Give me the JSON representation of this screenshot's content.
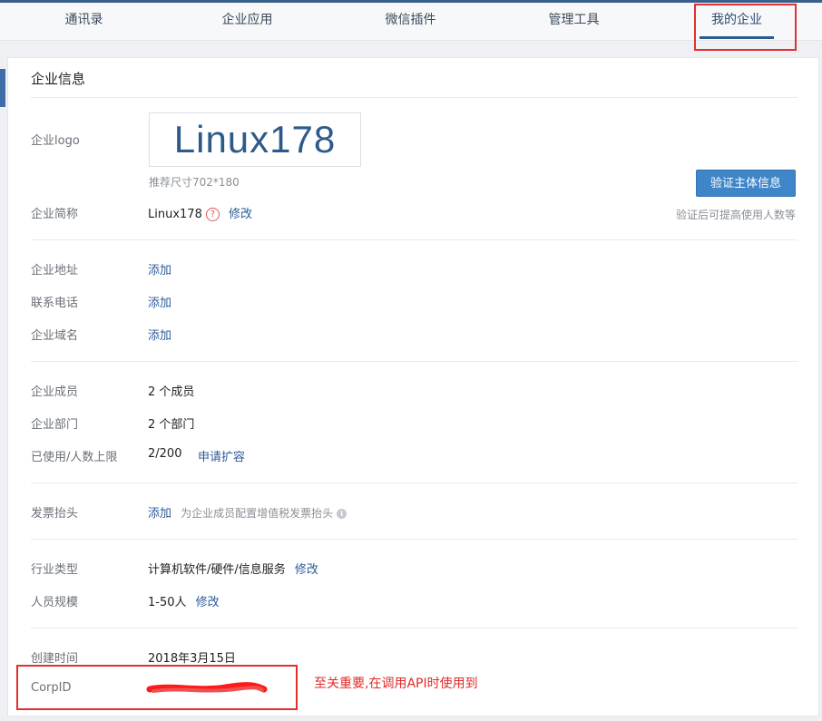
{
  "nav": {
    "tabs": [
      {
        "label": "通讯录"
      },
      {
        "label": "企业应用"
      },
      {
        "label": "微信插件"
      },
      {
        "label": "管理工具"
      },
      {
        "label": "我的企业"
      }
    ],
    "active_index": 4
  },
  "info": {
    "title": "企业信息",
    "logo_label": "企业logo",
    "logo_text": "Linux178",
    "logo_hint": "推荐尺寸702*180",
    "verify_button": "验证主体信息",
    "verify_hint": "验证后可提高使用人数等",
    "short_name_label": "企业简称",
    "short_name_value": "Linux178",
    "short_name_help": "?",
    "short_name_edit": "修改",
    "address_label": "企业地址",
    "address_action": "添加",
    "phone_label": "联系电话",
    "phone_action": "添加",
    "domain_label": "企业域名",
    "domain_action": "添加",
    "members_label": "企业成员",
    "members_value": "2 个成员",
    "depts_label": "企业部门",
    "depts_value": "2 个部门",
    "limit_label": "已使用/人数上限",
    "limit_value": "2/200",
    "limit_action": "申请扩容",
    "invoice_label": "发票抬头",
    "invoice_action": "添加",
    "invoice_hint": "为企业成员配置增值税发票抬头",
    "invoice_info_icon": "i",
    "industry_label": "行业类型",
    "industry_value": "计算机软件/硬件/信息服务",
    "industry_edit": "修改",
    "size_label": "人员规模",
    "size_value": "1-50人",
    "size_edit": "修改",
    "created_label": "创建时间",
    "created_value": "2018年3月15日",
    "corpid_label": "CorpID"
  },
  "annotation": {
    "text": "至关重要,在调用API时使用到"
  },
  "colors": {
    "accent": "#2e5b8f",
    "link": "#2b5b9a",
    "button": "#3f86c9",
    "highlight": "#e03030"
  }
}
